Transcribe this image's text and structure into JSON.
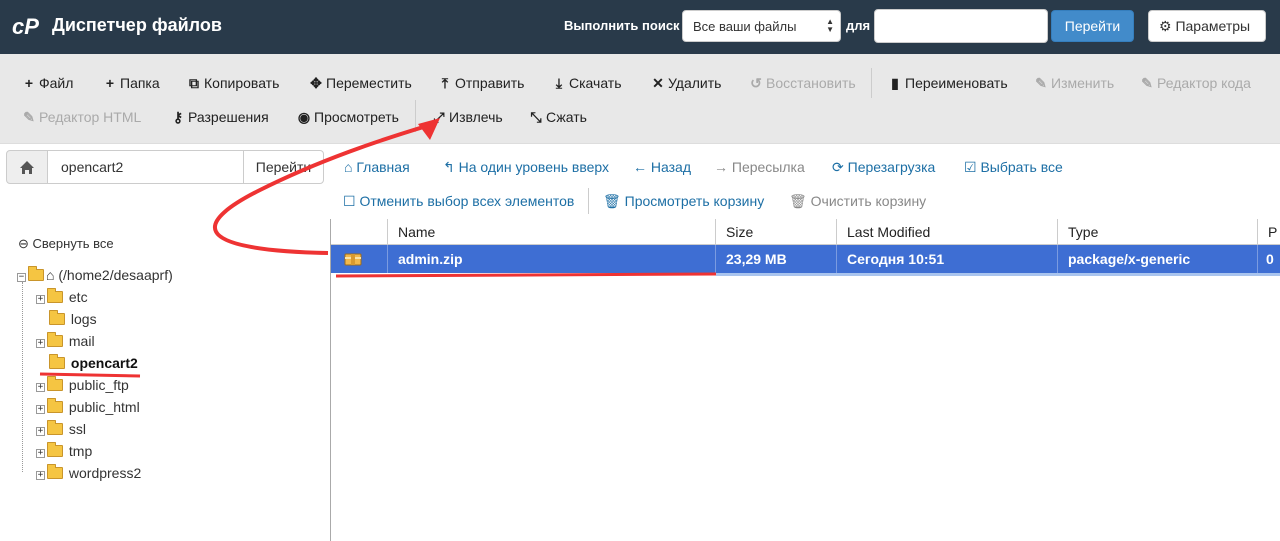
{
  "header": {
    "title": "Диспетчер файлов",
    "search_label": "Выполнить поиск",
    "search_scope": "Все ваши файлы",
    "for_label": "для",
    "search_value": "",
    "go_label": "Перейти",
    "settings_label": "Параметры"
  },
  "toolbar": {
    "file": "Файл",
    "folder": "Папка",
    "copy": "Копировать",
    "move": "Переместить",
    "upload": "Отправить",
    "download": "Скачать",
    "delete": "Удалить",
    "restore": "Восстановить",
    "rename": "Переименовать",
    "edit": "Изменить",
    "code_editor": "Редактор кода",
    "html_editor": "Редактор HTML",
    "permissions": "Разрешения",
    "view": "Просмотреть",
    "extract": "Извлечь",
    "compress": "Сжать"
  },
  "pathbar": {
    "path": "opencart2",
    "go_label": "Перейти"
  },
  "nav": {
    "home": "Главная",
    "up": "На один уровень вверх",
    "back": "Назад",
    "forward": "Пересылка",
    "reload": "Перезагрузка",
    "select_all": "Выбрать все",
    "unselect_all": "Отменить выбор всех элементов",
    "view_trash": "Просмотреть корзину",
    "empty_trash": "Очистить корзину"
  },
  "tree": {
    "collapse_all": "Свернуть все",
    "root": "(/home2/desaaprf)",
    "folders": [
      "etc",
      "logs",
      "mail",
      "opencart2",
      "public_ftp",
      "public_html",
      "ssl",
      "tmp",
      "wordpress2"
    ],
    "selected": "opencart2"
  },
  "table": {
    "columns": [
      "Name",
      "Size",
      "Last Modified",
      "Type",
      "P"
    ],
    "rows": [
      {
        "name": "admin.zip",
        "size": "23,29 MB",
        "modified": "Сегодня 10:51",
        "type": "package/x-generic",
        "perm": "0"
      }
    ]
  },
  "colors": {
    "header_bg": "#293a4a",
    "accent": "#428bca",
    "selected_row": "#3e6ed3",
    "annotation": "#ee3333"
  }
}
